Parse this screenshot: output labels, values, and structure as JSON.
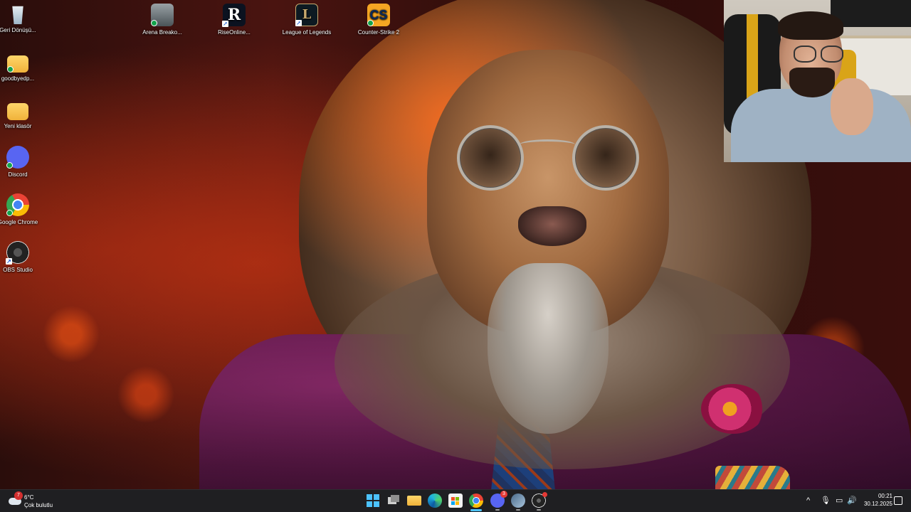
{
  "desktop": {
    "icons": [
      {
        "label": "Geri Dönüşü...",
        "icon": "recycle-bin-icon"
      },
      {
        "label": "goodbyedp...",
        "icon": "folder-icon"
      },
      {
        "label": "Yeni klasör",
        "icon": "folder-icon"
      },
      {
        "label": "Discord",
        "icon": "discord-icon"
      },
      {
        "label": "Google Chrome",
        "icon": "chrome-icon"
      },
      {
        "label": "OBS Studio",
        "icon": "obs-icon"
      },
      {
        "label": "Arena Breako...",
        "icon": "arena-breakout-icon"
      },
      {
        "label": "RiseOnline...",
        "icon": "rise-online-icon",
        "glyph": "R"
      },
      {
        "label": "League of Legends",
        "icon": "league-of-legends-icon",
        "glyph": "L"
      },
      {
        "label": "Counter-Strike 2",
        "icon": "counter-strike-icon",
        "glyph": "CS"
      }
    ]
  },
  "taskbar": {
    "weather": {
      "temperature": "6°C",
      "condition": "Çok bulutlu",
      "badge": "7"
    },
    "pinned": [
      {
        "name": "start-button"
      },
      {
        "name": "task-view"
      },
      {
        "name": "file-explorer"
      },
      {
        "name": "edge"
      },
      {
        "name": "microsoft-store"
      },
      {
        "name": "chrome",
        "active": true
      },
      {
        "name": "discord",
        "badge": "3"
      },
      {
        "name": "game-launcher"
      },
      {
        "name": "obs-studio"
      }
    ],
    "tray": {
      "chevron": "^",
      "mic": "🎙",
      "network": "▭",
      "volume": "🔊"
    },
    "clock": {
      "time": "00:21",
      "date": "30.12.2025"
    }
  },
  "colors": {
    "taskbar_bg": "#1f1f22",
    "accent": "#4cc2ff",
    "badge_red": "#e53935"
  }
}
